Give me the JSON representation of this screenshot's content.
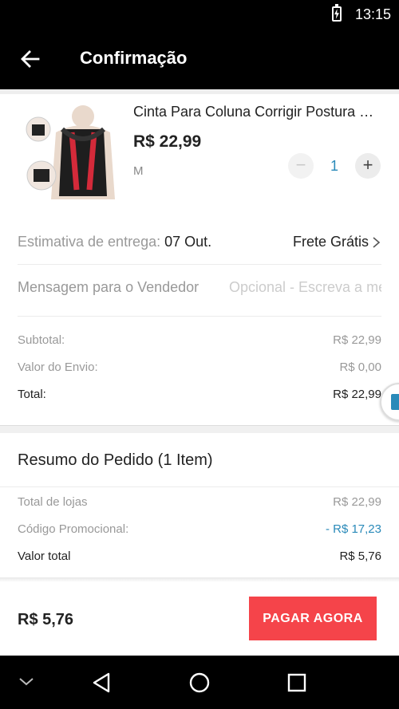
{
  "status_bar": {
    "time": "13:15"
  },
  "app_bar": {
    "title": "Confirmação"
  },
  "product": {
    "name": "Cinta Para Coluna Corrigir Postura Ortopédica",
    "price": "R$ 22,99",
    "variant": "M",
    "quantity": "1",
    "minus_label": "−",
    "plus_label": "+"
  },
  "delivery": {
    "label": "Estimativa de entrega:",
    "date": "07 Out.",
    "shipping": "Frete Grátis"
  },
  "message": {
    "label": "Mensagem para o Vendedor",
    "placeholder": "Opcional - Escreva a mensagem"
  },
  "costs": {
    "subtotal_label": "Subtotal:",
    "subtotal_value": "R$ 22,99",
    "shipping_label": "Valor do Envio:",
    "shipping_value": "R$ 0,00",
    "total_label": "Total:",
    "total_value": "R$ 22,99"
  },
  "summary": {
    "title": "Resumo do Pedido (1 Item)",
    "stores_label": "Total de lojas",
    "stores_value": "R$ 22,99",
    "promo_label": "Código Promocional:",
    "promo_value": "- R$ 17,23",
    "grand_label": "Valor total",
    "grand_value": "R$ 5,76"
  },
  "checkout": {
    "total": "R$ 5,76",
    "pay_label": "PAGAR AGORA"
  },
  "colors": {
    "accent_red": "#f5444a",
    "link_blue": "#2a8ab9",
    "bar_black": "#000000"
  },
  "icons": [
    "battery-charging-icon",
    "back-arrow-icon",
    "chevron-right-icon",
    "cube-icon",
    "nav-collapse-icon",
    "nav-back-icon",
    "nav-home-icon",
    "nav-recents-icon"
  ]
}
